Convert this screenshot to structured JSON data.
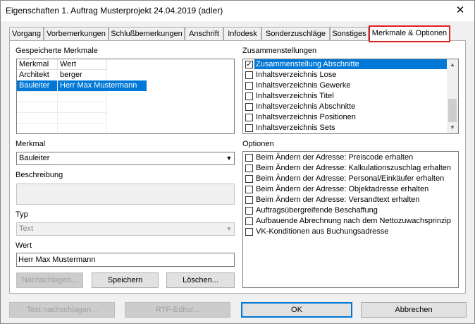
{
  "window": {
    "title": "Eigenschaften 1. Auftrag Musterprojekt 24.04.2019 (adler)",
    "close_symbol": "✕"
  },
  "tabs": [
    {
      "label": "Vorgang"
    },
    {
      "label": "Vorbemerkungen"
    },
    {
      "label": "Schlußbemerkungen"
    },
    {
      "label": "Anschrift"
    },
    {
      "label": "Infodesk"
    },
    {
      "label": "Sonderzuschläge"
    },
    {
      "label": "Sonstiges"
    },
    {
      "label": "Merkmale & Optionen"
    }
  ],
  "active_tab": "Merkmale & Optionen",
  "gespeicherte": {
    "label": "Gespeicherte Merkmale",
    "columns": [
      "Merkmal",
      "Wert"
    ],
    "rows": [
      {
        "merkmal": "Architekt",
        "wert": "berger",
        "selected": false
      },
      {
        "merkmal": "Bauleiter",
        "wert": "Herr Max Mustermann",
        "selected": true
      }
    ]
  },
  "zusammenstellungen": {
    "label": "Zusammenstellungen",
    "items": [
      {
        "label": "Zusammenstellung Abschnitte",
        "checked": true,
        "selected": true
      },
      {
        "label": "Inhaltsverzeichnis Lose",
        "checked": false,
        "selected": false
      },
      {
        "label": "Inhaltsverzeichnis Gewerke",
        "checked": false,
        "selected": false
      },
      {
        "label": "Inhaltsverzeichnis Titel",
        "checked": false,
        "selected": false
      },
      {
        "label": "Inhaltsverzeichnis Abschnitte",
        "checked": false,
        "selected": false
      },
      {
        "label": "Inhaltsverzeichnis Positionen",
        "checked": false,
        "selected": false
      },
      {
        "label": "Inhaltsverzeichnis Sets",
        "checked": false,
        "selected": false
      }
    ]
  },
  "merkmal": {
    "label": "Merkmal",
    "value": "Bauleiter"
  },
  "beschreibung": {
    "label": "Beschreibung",
    "value": ""
  },
  "typ": {
    "label": "Typ",
    "value": "Text"
  },
  "wert": {
    "label": "Wert",
    "value": "Herr Max Mustermann"
  },
  "optionen": {
    "label": "Optionen",
    "items": [
      {
        "label": "Beim Ändern der Adresse: Preiscode erhalten",
        "checked": false
      },
      {
        "label": "Beim Ändern der Adresse: Kalkulationszuschlag erhalten",
        "checked": false
      },
      {
        "label": "Beim Ändern der Adresse: Personal/Einkäufer erhalten",
        "checked": false
      },
      {
        "label": "Beim Ändern der Adresse: Objektadresse erhalten",
        "checked": false
      },
      {
        "label": "Beim Ändern der Adresse: Versandtext erhalten",
        "checked": false
      },
      {
        "label": "Auftragsübergreifende Beschaffung",
        "checked": false
      },
      {
        "label": "Aufbauende Abrechnung nach dem Nettozuwachsprinzip",
        "checked": false
      },
      {
        "label": "VK-Konditionen aus Buchungsadresse",
        "checked": false
      }
    ]
  },
  "buttons": {
    "nachschlagen": "Nachschlagen...",
    "speichern": "Speichern",
    "loeschen": "Löschen...",
    "text_nachschlagen": "Text nachschlagen...",
    "rtf_editor": "RTF-Editor...",
    "ok": "OK",
    "abbrechen": "Abbrechen"
  },
  "icons": {
    "check": "check-icon",
    "dropdown": "chevron-down-icon",
    "scroll_up": "scroll-up-icon",
    "scroll_down": "scroll-down-icon"
  },
  "colors": {
    "selection": "#0078d7",
    "active_tab_border": "#e02020"
  }
}
